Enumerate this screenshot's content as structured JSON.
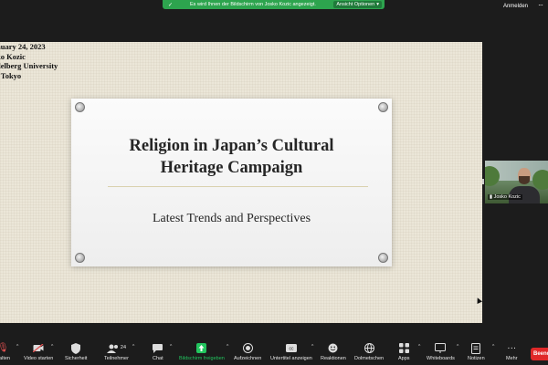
{
  "banner": {
    "message": "Es wird Ihnen der Bildschirm von Josko Kozic angezeigt.",
    "options_label": "Ansicht Optionen",
    "options_caret": "▾"
  },
  "topbar": {
    "sign_in": "Anmelden",
    "more": "···"
  },
  "slide": {
    "corner_lines": [
      "nuary 24, 2023",
      "ko Kozic",
      "delberg University",
      "f Tokyo"
    ],
    "title_line1": "Religion in Japan’s Cultural",
    "title_line2": "Heritage Campaign",
    "subtitle": "Latest Trends and Perspectives"
  },
  "participant": {
    "name": "Josko Kozic"
  },
  "toolbar": {
    "items": [
      {
        "label": "halten",
        "icon": "mic-icon"
      },
      {
        "label": "Video starten",
        "icon": "video-off-icon"
      },
      {
        "label": "Sicherheit",
        "icon": "shield-icon"
      },
      {
        "label": "Teilnehmer",
        "icon": "participants-icon",
        "badge": "24"
      },
      {
        "label": "Chat",
        "icon": "chat-icon"
      },
      {
        "label": "Bildschirm freigeben",
        "icon": "share-screen-icon"
      },
      {
        "label": "Aufzeichnen",
        "icon": "record-icon"
      },
      {
        "label": "Untertitel anzeigen",
        "icon": "captions-icon"
      },
      {
        "label": "Reaktionen",
        "icon": "reactions-icon"
      },
      {
        "label": "Dolmetschen",
        "icon": "globe-icon"
      },
      {
        "label": "Apps",
        "icon": "apps-icon"
      },
      {
        "label": "Whiteboards",
        "icon": "whiteboard-icon"
      },
      {
        "label": "Notizen",
        "icon": "notes-icon"
      },
      {
        "label": "Mehr",
        "icon": "more-icon"
      }
    ],
    "end_label": "Beend"
  },
  "colors": {
    "banner": "#2da44e",
    "share_accent": "#22c55e",
    "end": "#e02828"
  }
}
